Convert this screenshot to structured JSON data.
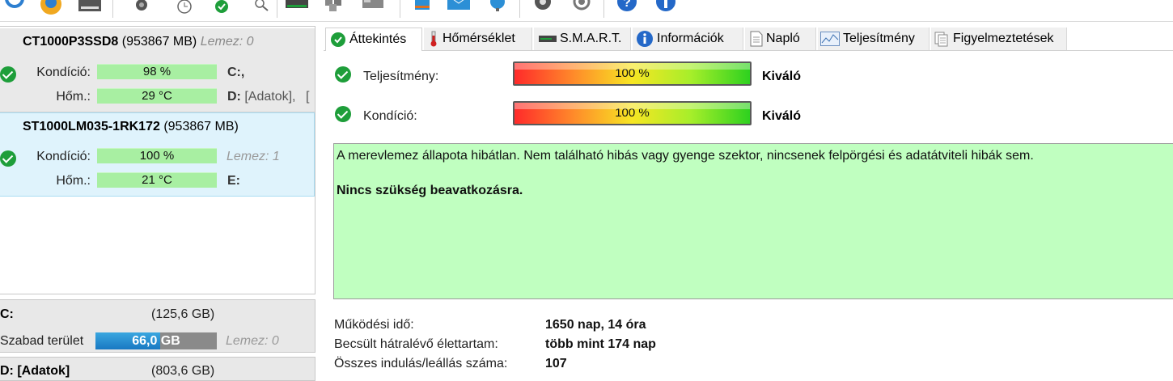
{
  "toolbar": {
    "icons": [
      "refresh-icon",
      "warning-icon",
      "drive-icon",
      "disk-speaker-icon",
      "clock-icon",
      "health-check-icon",
      "magnify-icon",
      "scanner-icon",
      "cubes-icon",
      "server-icon",
      "book-icon",
      "mail-icon",
      "network-icon",
      "gear-icon",
      "speaker-icon",
      "help-icon",
      "info-icon"
    ]
  },
  "disks": [
    {
      "model": "CT1000P3SSD8",
      "size": "(953867 MB)",
      "disk_index": "Lemez: 0",
      "condition_label": "Kondíció:",
      "condition_value": "98 %",
      "temp_label": "Hőm.:",
      "temp_value": "29 °C",
      "partition_1": "C:,",
      "partition_2_letter": "D:",
      "partition_2_name": "[Adatok],",
      "partition_2_more": "["
    },
    {
      "model": "ST1000LM035-1RK172",
      "size": "(953867 MB)",
      "condition_label": "Kondíció:",
      "condition_value": "100 %",
      "temp_label": "Hőm.:",
      "temp_value": "21 °C",
      "disk_index": "Lemez: 1",
      "partition_1": "E:"
    }
  ],
  "volumes": [
    {
      "name": "C:",
      "size": "(125,6 GB)",
      "free_label": "Szabad terület",
      "free_value": "66,0 GB",
      "free_fraction": 0.53,
      "disk": "Lemez: 0"
    },
    {
      "name": "D: [Adatok]",
      "size": "(803,6 GB)"
    }
  ],
  "tabs": [
    {
      "label": "Áttekintés",
      "icon": "check-icon",
      "active": true
    },
    {
      "label": "Hőmérséklet",
      "icon": "thermometer-icon"
    },
    {
      "label": "S.M.A.R.T.",
      "icon": "drive-icon"
    },
    {
      "label": "Információk",
      "icon": "info-icon"
    },
    {
      "label": "Napló",
      "icon": "document-icon"
    },
    {
      "label": "Teljesítmény",
      "icon": "chart-icon"
    },
    {
      "label": "Figyelmeztetések",
      "icon": "alerts-icon"
    }
  ],
  "overview": {
    "performance_label": "Teljesítmény:",
    "performance_value": "100 %",
    "performance_fraction": 1.0,
    "performance_rating": "Kiváló",
    "health_label": "Kondíció:",
    "health_value": "100 %",
    "health_fraction": 1.0,
    "health_rating": "Kiváló",
    "status_text": "A merevlemez állapota hibátlan. Nem található hibás vagy gyenge szektor, nincsenek felpörgési és adatátviteli hibák sem.",
    "status_advice": "Nincs szükség beavatkozásra.",
    "uptime_label": "Működési idő:",
    "uptime_value": "1650 nap, 14 óra",
    "lifetime_label": "Becsült hátralévő élettartam:",
    "lifetime_value": "több mint 174 nap",
    "startstop_label": "Összes indulás/leállás száma:",
    "startstop_value": "107"
  },
  "colors": {
    "health_box": "#c0ffc0",
    "selected_disk": "#dff3fc",
    "ok_green": "#1e9e3a",
    "free_bar": "#1878c2"
  }
}
